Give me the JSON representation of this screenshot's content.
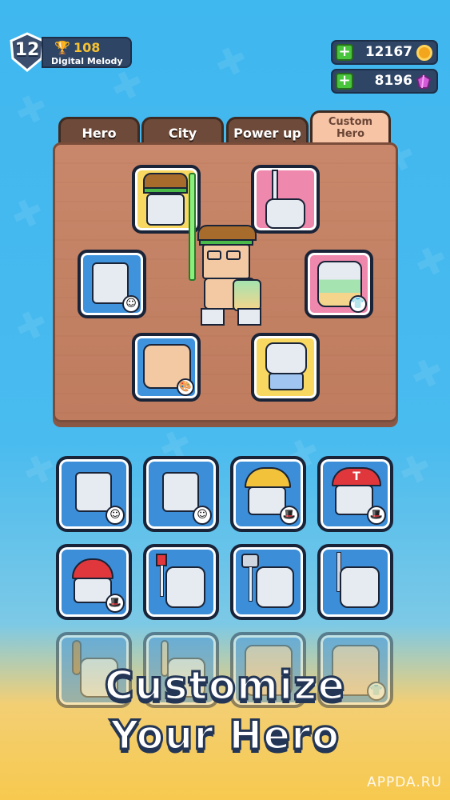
{
  "player": {
    "level": "12",
    "trophies": "108",
    "name": "Digital Melody"
  },
  "currency": {
    "coins": "12167",
    "gems": "8196",
    "plus": "+"
  },
  "tabs": [
    {
      "label": "Hero"
    },
    {
      "label": "City"
    },
    {
      "label": "Power up"
    },
    {
      "label": "Custom\nHero"
    }
  ],
  "banner": {
    "line1": "Customize",
    "line2": "Your Hero"
  },
  "watermark": "APPDA.RU",
  "icons": {
    "smile": "smile-icon",
    "shirt": "shirt-icon",
    "palette": "palette-icon",
    "hat": "hat-icon"
  }
}
